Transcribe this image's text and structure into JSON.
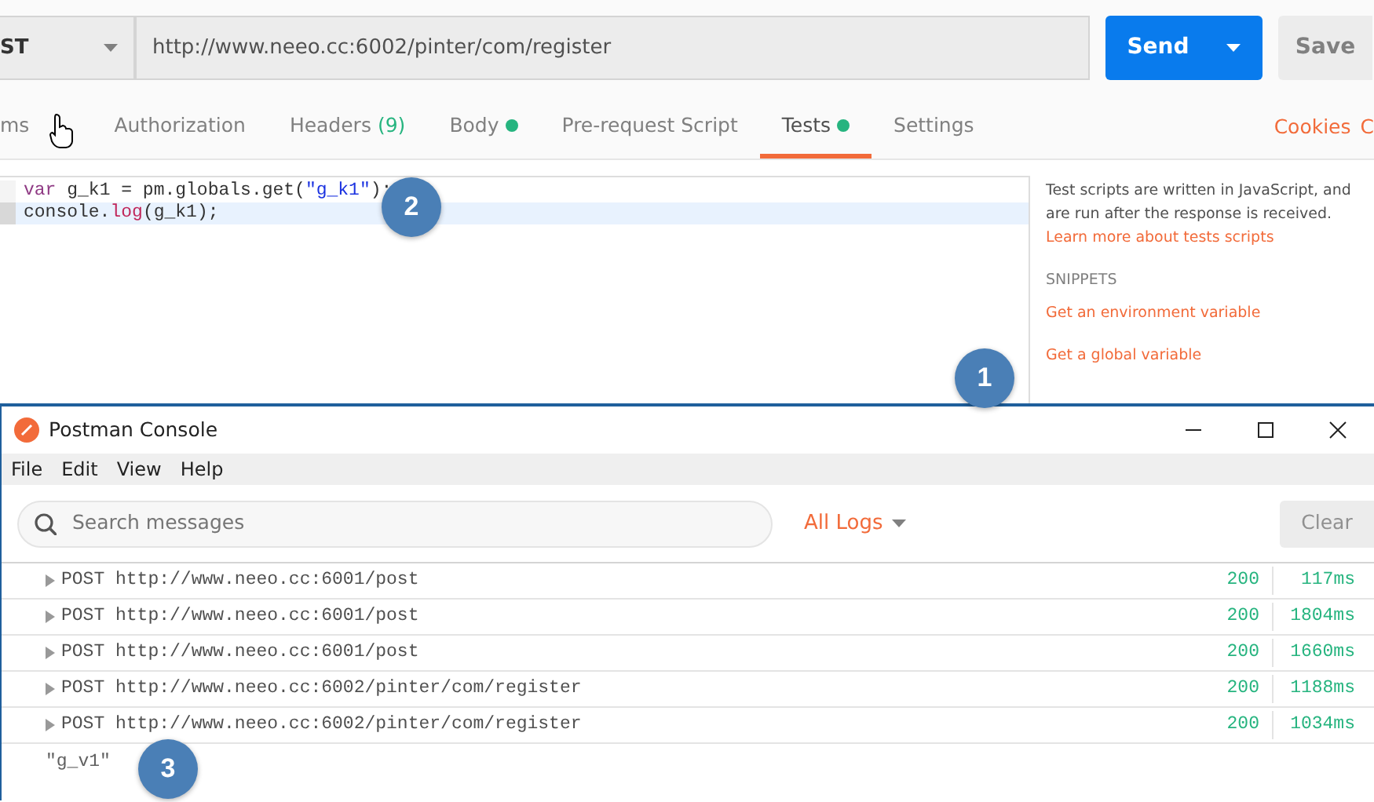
{
  "request": {
    "method": "ST",
    "url": "http://www.neeo.cc:6002/pinter/com/register",
    "send": "Send",
    "save": "Save"
  },
  "tabs": [
    {
      "label": "ms",
      "dot": false,
      "selected": false
    },
    {
      "label": "Authorization",
      "dot": false,
      "selected": false
    },
    {
      "label": "Headers",
      "count": "(9)",
      "dot": false,
      "selected": false
    },
    {
      "label": "Body",
      "dot": true,
      "selected": false
    },
    {
      "label": "Pre-request Script",
      "dot": false,
      "selected": false
    },
    {
      "label": "Tests",
      "dot": true,
      "selected": true
    },
    {
      "label": "Settings",
      "dot": false,
      "selected": false
    }
  ],
  "tab_links": [
    "Cookies",
    "C"
  ],
  "editor": {
    "lines": [
      {
        "active": false,
        "tokens": [
          {
            "kind": "keyword",
            "text": "var"
          },
          {
            "kind": "plain",
            "text": " g_k1 = pm.globals.get("
          },
          {
            "kind": "string",
            "text": "\"g_k1\""
          },
          {
            "kind": "plain",
            "text": ");"
          }
        ]
      },
      {
        "active": true,
        "tokens": [
          {
            "kind": "plain",
            "text": "console."
          },
          {
            "kind": "function",
            "text": "log"
          },
          {
            "kind": "plain",
            "text": "(g_k1);"
          }
        ]
      }
    ]
  },
  "help": {
    "text": "Test scripts are written in JavaScript, and are run after the response is received.",
    "link": "Learn more about tests scripts",
    "snippets_title": "SNIPPETS",
    "snippets": [
      "Get an environment variable",
      "Get a global variable"
    ]
  },
  "console": {
    "title": "Postman Console",
    "menu": [
      "File",
      "Edit",
      "View",
      "Help"
    ],
    "search": {
      "placeholder": "Search messages"
    },
    "filter": "All Logs",
    "clear": "Clear",
    "logs": [
      {
        "kind": "request",
        "method": "POST",
        "url": "http://www.neeo.cc:6001/post",
        "status": "200",
        "time": "117ms"
      },
      {
        "kind": "request",
        "method": "POST",
        "url": "http://www.neeo.cc:6001/post",
        "status": "200",
        "time": "1804ms"
      },
      {
        "kind": "request",
        "method": "POST",
        "url": "http://www.neeo.cc:6001/post",
        "status": "200",
        "time": "1660ms"
      },
      {
        "kind": "request",
        "method": "POST",
        "url": "http://www.neeo.cc:6002/pinter/com/register",
        "status": "200",
        "time": "1188ms"
      },
      {
        "kind": "request",
        "method": "POST",
        "url": "http://www.neeo.cc:6002/pinter/com/register",
        "status": "200",
        "time": "1034ms"
      },
      {
        "kind": "message",
        "text": "\"g_v1\""
      }
    ]
  },
  "annotations": [
    {
      "label": "1"
    },
    {
      "label": "2"
    },
    {
      "label": "3"
    }
  ]
}
